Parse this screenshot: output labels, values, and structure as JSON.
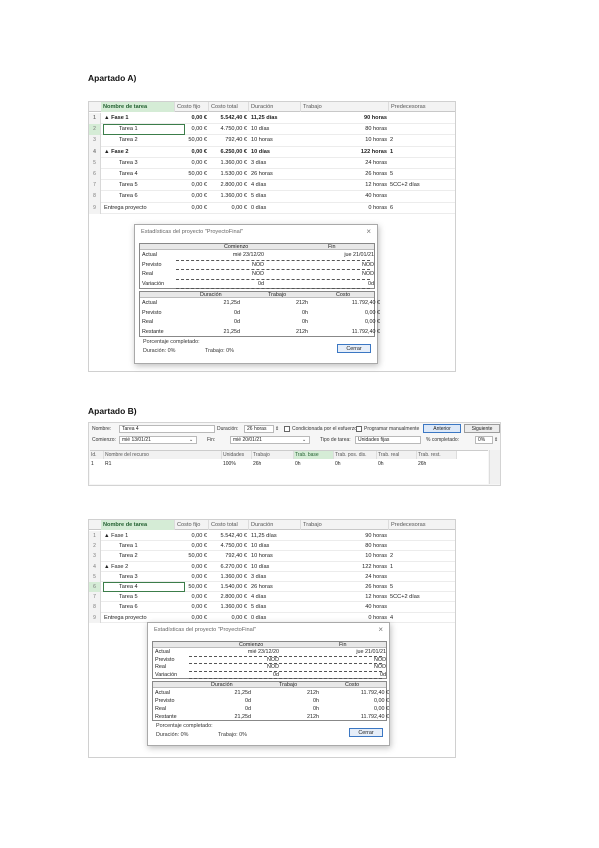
{
  "headings": {
    "a": "Apartado A)",
    "b": "Apartado B)"
  },
  "grid_columns": [
    "Nombre de tarea",
    "Costo fijo",
    "Costo total",
    "Duración",
    "Trabajo",
    "Predecesoras"
  ],
  "grid_a": {
    "rows": [
      {
        "num": "1",
        "name": "▲ Fase 1",
        "costo_fijo": "0,00 €",
        "costo_total": "5.542,40 €",
        "duracion": "11,25 días",
        "trabajo": "90 horas",
        "pred": "",
        "bold": true
      },
      {
        "num": "2",
        "name": "Tarea 1",
        "costo_fijo": "0,00 €",
        "costo_total": "4.750,00 €",
        "duracion": "10 días",
        "trabajo": "80 horas",
        "pred": "",
        "bold": false
      },
      {
        "num": "3",
        "name": "Tarea 2",
        "costo_fijo": "50,00 €",
        "costo_total": "792,40 €",
        "duracion": "10 horas",
        "trabajo": "10 horas",
        "pred": "2",
        "bold": false
      },
      {
        "num": "4",
        "name": "▲ Fase 2",
        "costo_fijo": "0,00 €",
        "costo_total": "6.250,00 €",
        "duracion": "10 días",
        "trabajo": "122 horas",
        "pred": "1",
        "bold": true
      },
      {
        "num": "5",
        "name": "Tarea 3",
        "costo_fijo": "0,00 €",
        "costo_total": "1.360,00 €",
        "duracion": "3 días",
        "trabajo": "24 horas",
        "pred": "",
        "bold": false
      },
      {
        "num": "6",
        "name": "Tarea 4",
        "costo_fijo": "50,00 €",
        "costo_total": "1.530,00 €",
        "duracion": "26 horas",
        "trabajo": "26 horas",
        "pred": "5",
        "bold": false
      },
      {
        "num": "7",
        "name": "Tarea 5",
        "costo_fijo": "0,00 €",
        "costo_total": "2.800,00 €",
        "duracion": "4 días",
        "trabajo": "12 horas",
        "pred": "5CC+2 días",
        "bold": false
      },
      {
        "num": "8",
        "name": "Tarea 6",
        "costo_fijo": "0,00 €",
        "costo_total": "1.360,00 €",
        "duracion": "5 días",
        "trabajo": "40 horas",
        "pred": "",
        "bold": false
      },
      {
        "num": "9",
        "name": "Entrega proyecto",
        "costo_fijo": "0,00 €",
        "costo_total": "0,00 €",
        "duracion": "0 días",
        "trabajo": "0 horas",
        "pred": "6",
        "bold": false
      }
    ]
  },
  "grid_c": {
    "rows": [
      {
        "num": "1",
        "name": "▲ Fase 1",
        "costo_fijo": "0,00 €",
        "costo_total": "5.542,40 €",
        "duracion": "11,25 días",
        "trabajo": "90 horas",
        "pred": "",
        "bold": false
      },
      {
        "num": "2",
        "name": "Tarea 1",
        "costo_fijo": "0,00 €",
        "costo_total": "4.750,00 €",
        "duracion": "10 días",
        "trabajo": "80 horas",
        "pred": "",
        "bold": false
      },
      {
        "num": "3",
        "name": "Tarea 2",
        "costo_fijo": "50,00 €",
        "costo_total": "792,40 €",
        "duracion": "10 horas",
        "trabajo": "10 horas",
        "pred": "2",
        "bold": false
      },
      {
        "num": "4",
        "name": "▲ Fase 2",
        "costo_fijo": "0,00 €",
        "costo_total": "6.270,00 €",
        "duracion": "10 días",
        "trabajo": "122 horas",
        "pred": "1",
        "bold": false
      },
      {
        "num": "5",
        "name": "Tarea 3",
        "costo_fijo": "0,00 €",
        "costo_total": "1.360,00 €",
        "duracion": "3 días",
        "trabajo": "24 horas",
        "pred": "",
        "bold": false
      },
      {
        "num": "6",
        "name": "Tarea 4",
        "costo_fijo": "50,00 €",
        "costo_total": "1.540,00 €",
        "duracion": "26 horas",
        "trabajo": "26 horas",
        "pred": "5",
        "bold": false
      },
      {
        "num": "7",
        "name": "Tarea 5",
        "costo_fijo": "0,00 €",
        "costo_total": "2.800,00 €",
        "duracion": "4 días",
        "trabajo": "12 horas",
        "pred": "5CC+2 días",
        "bold": false
      },
      {
        "num": "8",
        "name": "Tarea 6",
        "costo_fijo": "0,00 €",
        "costo_total": "1.360,00 €",
        "duracion": "5 días",
        "trabajo": "40 horas",
        "pred": "",
        "bold": false
      },
      {
        "num": "9",
        "name": "Entrega proyecto",
        "costo_fijo": "0,00 €",
        "costo_total": "0,00 €",
        "duracion": "0 días",
        "trabajo": "0 horas",
        "pred": "4",
        "bold": false
      }
    ]
  },
  "dialog": {
    "title_a": "Estadísticas del proyecto \"ProyectoFinal\"",
    "title_c": "Estadísticas del proyecto \"ProyectoFinal\"",
    "close": "×",
    "col_comienzo": "Comienzo",
    "col_fin": "Fin",
    "top_rows": [
      {
        "label": "Actual",
        "comienzo": "mié 23/12/20",
        "fin": "jue 21/01/21"
      },
      {
        "label": "Previsto",
        "comienzo": "NOD",
        "fin": "NOD"
      },
      {
        "label": "Real",
        "comienzo": "NOD",
        "fin": "NOD"
      },
      {
        "label": "Variación",
        "comienzo": "0d",
        "fin": "0d"
      }
    ],
    "col_duracion": "Duración",
    "col_trabajo": "Trabajo",
    "col_costo": "Costo",
    "bottom_rows": [
      {
        "label": "Actual",
        "duracion": "21,25d",
        "trabajo": "212h",
        "costo": "11.792,40 €"
      },
      {
        "label": "Previsto",
        "duracion": "0d",
        "trabajo": "0h",
        "costo": "0,00 €"
      },
      {
        "label": "Real",
        "duracion": "0d",
        "trabajo": "0h",
        "costo": "0,00 €"
      },
      {
        "label": "Restante",
        "duracion": "21,25d",
        "trabajo": "212h",
        "costo": "11.792,40 €"
      }
    ],
    "porcentaje_label": "Porcentaje completado:",
    "duracion_pct": "Duración: 0%",
    "trabajo_pct": "Trabajo: 0%",
    "cerrar": "Cerrar"
  },
  "form": {
    "nombre_label": "Nombre:",
    "nombre_value": "Tarea 4",
    "duracion_label": "Duración:",
    "duracion_value": "26 horas",
    "esfuerzo_label": "Condicionada por el esfuerzo",
    "manual_label": "Programar manualmente",
    "anterior": "Anterior",
    "siguiente": "Siguiente",
    "comienzo_label": "Comienzo:",
    "comienzo_value": "mié 13/01/21",
    "fin_label": "Fin:",
    "fin_value": "mié 20/01/21",
    "tipo_label": "Tipo de tarea:",
    "tipo_value": "Unidades fijas",
    "pct_label": "% completado:",
    "pct_value": "0%",
    "table_headers": [
      "Id.",
      "Nombre del recurso",
      "Unidades",
      "Trabajo",
      "Trab. base",
      "Trab. pos. dis.",
      "Trab. real",
      "Trab. rest."
    ],
    "table_row": [
      "1",
      "R1",
      "100%",
      "26h",
      "0h",
      "0h",
      "0h",
      "26h"
    ]
  }
}
